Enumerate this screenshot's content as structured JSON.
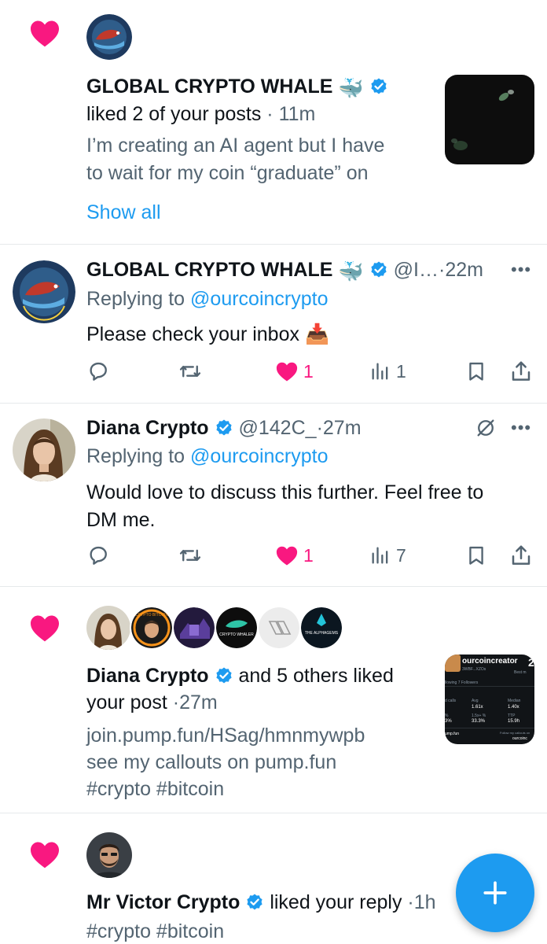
{
  "colors": {
    "accent": "#1d9bf0",
    "like": "#f91880",
    "muted": "#536471",
    "text": "#0f1419"
  },
  "notif1": {
    "icon": "heart-icon",
    "name": "GLOBAL CRYPTO WHALE",
    "name_emoji": "🐳",
    "action": "liked 2 of your posts",
    "sep": "·",
    "time": "11m",
    "preview_line1": "I’m creating an AI agent but I have",
    "preview_line2": "to wait for my coin “graduate” on",
    "show_all": "Show all",
    "avatar_text": "GLOBAL CRYPTO WHALE"
  },
  "reply1": {
    "name": "GLOBAL CRYPTO WHALE",
    "name_emoji": "🐳",
    "handle": "@I…",
    "sep": "·",
    "time": "22m",
    "replying_prefix": "Replying to",
    "replying_to": "@ourcoincrypto",
    "text": "Please check your inbox",
    "text_emoji": "📥",
    "likes": "1",
    "views": "1",
    "avatar_text": "GLOBAL CRYPTO WHALE"
  },
  "reply2": {
    "name": "Diana Crypto",
    "handle": "@142C_",
    "sep": "·",
    "time": "27m",
    "replying_prefix": "Replying to",
    "replying_to": "@ourcoincrypto",
    "text_line1": "Would love to discuss this further. Feel free to",
    "text_line2": "DM me.",
    "likes": "1",
    "views": "7"
  },
  "notif2": {
    "icon": "heart-icon",
    "name": "Diana Crypto",
    "action_rest": "and 5 others liked",
    "action_line2": "your post",
    "sep": "·",
    "time": "27m",
    "post_line1": "join.pump.fun/HSag/hmnmywpb",
    "post_line2": "see my callouts on pump.fun",
    "post_line3": "#crypto #bitcoin",
    "avatars": [
      "Diana Crypto",
      "CRYPTO BITCOIN",
      "purple avatar",
      "CRYPTO WHALER",
      "logo avatar",
      "THE ALPHAGEMS"
    ],
    "avatar4_text": "CRYPTO WHALER",
    "avatar6_text": "THE ALPHAGEMS",
    "avatar2_text": "CRYPTO BITCOIN",
    "thumb": {
      "title": "ourcoincreator",
      "sub": "3WBF...XZOs",
      "badge": "2",
      "best": "Best m",
      "following": "llowing",
      "followers": "7 Followers",
      "calls": "d calls",
      "avg_label": "Avg",
      "avg_value": "1.61x",
      "median_label": "Median",
      "median_value": "1.40x",
      "pct1": "%",
      "pct_value": "3%",
      "ratio_label": "1.5x+ %",
      "ratio_value": "33.3%",
      "ttp_label": "TTP",
      "ttp_value": "15.9h",
      "site": "ump.fun",
      "follow": "Follow my callouts on",
      "handle": "ourcoinc"
    }
  },
  "notif3": {
    "icon": "heart-icon",
    "name": "Mr Victor Crypto",
    "action": "liked your reply",
    "sep": "·",
    "time": "1h",
    "post_line1": "#crypto #bitcoin"
  },
  "fab": {
    "icon": "plus-icon"
  }
}
